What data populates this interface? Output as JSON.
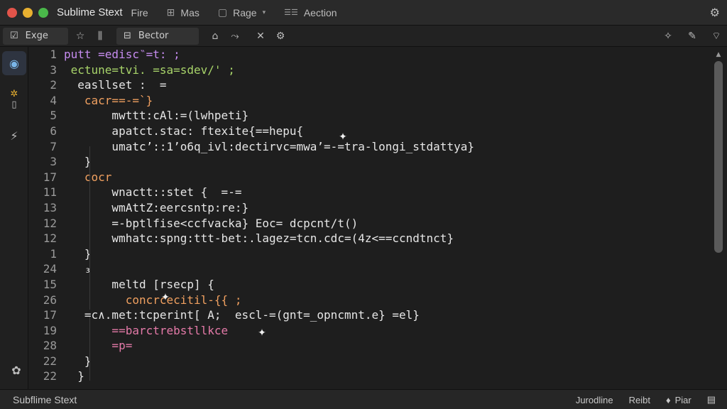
{
  "window": {
    "title": "Sublime Stext",
    "menu": [
      {
        "label": "Fire",
        "icon": "file-icon"
      },
      {
        "label": "Mas",
        "icon": "grid-icon"
      },
      {
        "label": "Rage",
        "icon": "page-icon"
      },
      {
        "label": "Aection",
        "icon": "action-icon"
      }
    ]
  },
  "toolbar": {
    "tab1_label": "Exge",
    "tab2_label": "Bector"
  },
  "gutter": {
    "line_numbers": [
      "1",
      "3",
      "2",
      "4",
      "5",
      "6",
      "7",
      "3",
      "17",
      "11",
      "13",
      "12",
      "12",
      "1",
      "24",
      "15",
      "26",
      "17",
      "19",
      "28",
      "22",
      "22"
    ]
  },
  "code": {
    "lines": [
      "putt =edisc‶=t: ;",
      " ectune=tvi. =sa=sdev/' ;",
      "  easllset :  =",
      "   cacr==-=`}",
      "       mwttt:cAl:=(lwhpeti}",
      "       apatct.stac: ftexite{==hepu⁡{",
      "       umatc’::1’o6q_ivl:dectirvc=mwa’=-=tra-longi_stdattya}",
      "   }",
      "   cocr",
      "       wnactt::stet {  =-=",
      "       wmAttZ:eercsntp:re:}",
      "       =-bptlfise<ccfvacka} Eoc= dcpcnt/t()",
      "       wmhatc:spng:ttt-bet:.lagez=tcn.cdc=(4z<==ccndtnct}",
      "   }",
      "   ₃",
      "       meltd [rsecp] {",
      "         concrcecitil-{{ ;",
      "   =c∧.met:tcperint[ A;  escl-=(gnt=_opncmnt.e} =el}",
      "       ==barctrebstllkce  ",
      "       =p=",
      "   }",
      "  }"
    ]
  },
  "statusbar": {
    "left": "Subflime Stext",
    "right1": "Jurodline",
    "right2": "Reibt",
    "right3": "Piar"
  }
}
